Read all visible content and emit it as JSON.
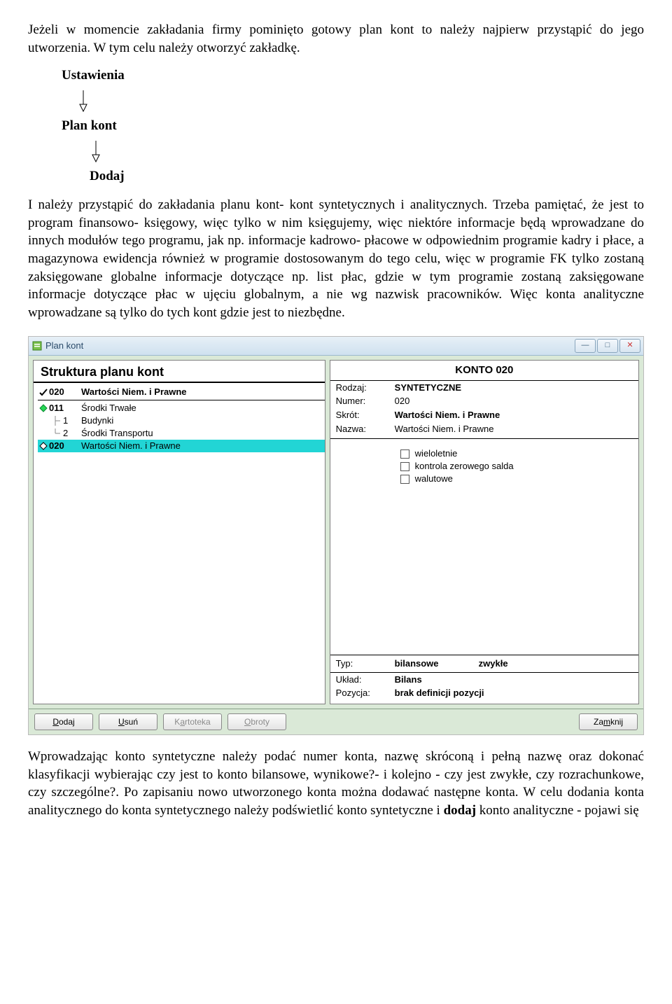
{
  "para1": "Jeżeli w momencie zakładania firmy pominięto gotowy plan kont to należy najpierw przystąpić do jego utworzenia. W tym celu należy otworzyć zakładkę.",
  "chain": {
    "a": "Ustawienia",
    "b": "Plan kont",
    "c": "Dodaj"
  },
  "para2": "I należy przystąpić do zakładania planu kont- kont syntetycznych i analitycznych. Trzeba pamiętać, że jest to program finansowo- księgowy, więc tylko w nim księgujemy, więc niektóre informacje będą wprowadzane do innych modułów tego programu, jak np. informacje kadrowo- płacowe w odpowiednim programie kadry i płace, a magazynowa ewidencja również w programie dostosowanym do tego celu, więc w programie FK tylko zostaną zaksięgowane globalne informacje dotyczące np. list płac, gdzie w tym programie zostaną zaksięgowane informacje dotyczące płac w ujęciu globalnym, a nie wg nazwisk pracowników. Więc konta analityczne wprowadzane są tylko do tych kont gdzie jest to niezbędne.",
  "window": {
    "title": "Plan kont",
    "left_header": "Struktura planu kont",
    "head_row": {
      "code": "020",
      "label": "Wartości Niem. i Prawne"
    },
    "tree": [
      {
        "code": "011",
        "label": "Środki Trwałe",
        "icon": "dia-green"
      },
      {
        "code": "1",
        "label": "Budynki",
        "child": true
      },
      {
        "code": "2",
        "label": "Środki Transportu",
        "child": true
      },
      {
        "code": "020",
        "label": "Wartości Niem. i Prawne",
        "icon": "dia-white",
        "selected": true
      }
    ],
    "right": {
      "title": "KONTO  020",
      "rodzaj_k": "Rodzaj:",
      "rodzaj_v": "SYNTETYCZNE",
      "numer_k": "Numer:",
      "numer_v": "020",
      "skrot_k": "Skrót:",
      "skrot_v": "Wartości Niem. i Prawne",
      "nazwa_k": "Nazwa:",
      "nazwa_v": "Wartości Niem. i Prawne",
      "checks": [
        "wieloletnie",
        "kontrola zerowego salda",
        "walutowe"
      ],
      "typ_k": "Typ:",
      "typ_v1": "bilansowe",
      "typ_v2": "zwykłe",
      "uklad_k": "Układ:",
      "uklad_v": "Bilans",
      "pozycja_k": "Pozycja:",
      "pozycja_v": "brak definicji pozycji"
    },
    "buttons": {
      "dodaj": "Dodaj",
      "usun": "Usuń",
      "kartoteka": "Kartoteka",
      "obroty": "Obroty",
      "zamknij": "Zamknij"
    }
  },
  "para3_parts": {
    "a": "Wprowadzając konto syntetyczne należy podać numer konta, nazwę skróconą i pełną nazwę oraz dokonać klasyfikacji wybierając czy jest to konto bilansowe, wynikowe?- i kolejno - czy jest zwykłe, czy rozrachunkowe, czy szczególne?. Po zapisaniu nowo utworzonego konta można dodawać  następne konta. W celu dodania  konta analitycznego do konta syntetycznego należy podświetlić konto syntetyczne i ",
    "b": "dodaj",
    "c": " konto analityczne - pojawi się"
  }
}
